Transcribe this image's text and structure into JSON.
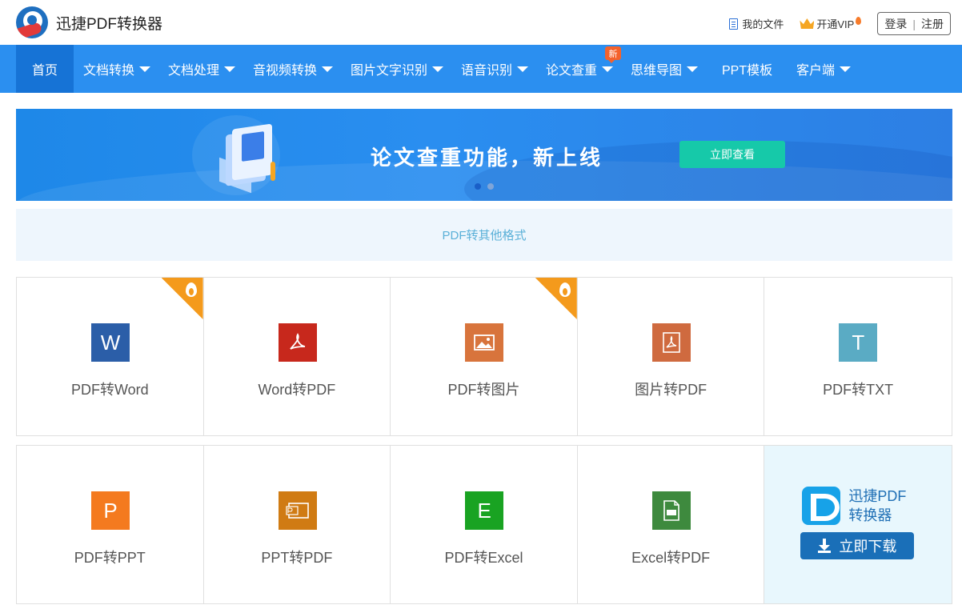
{
  "header": {
    "brand": "迅捷PDF转换器",
    "my_files": "我的文件",
    "vip": "开通VIP",
    "login": "登录",
    "separator": "|",
    "register": "注册"
  },
  "nav": {
    "items": [
      {
        "label": "首页",
        "dropdown": false,
        "active": true
      },
      {
        "label": "文档转换",
        "dropdown": true
      },
      {
        "label": "文档处理",
        "dropdown": true
      },
      {
        "label": "音视频转换",
        "dropdown": true
      },
      {
        "label": "图片文字识别",
        "dropdown": true
      },
      {
        "label": "语音识别",
        "dropdown": true
      },
      {
        "label": "论文查重",
        "dropdown": true
      },
      {
        "label": "思维导图",
        "dropdown": true
      },
      {
        "label": "PPT模板",
        "dropdown": false
      },
      {
        "label": "客户端",
        "dropdown": true
      }
    ],
    "new_badge": "新"
  },
  "banner": {
    "text": "论文查重功能，新上线",
    "button": "立即查看"
  },
  "section": {
    "title": "PDF转其他格式"
  },
  "tools_row1": [
    {
      "label": "PDF转Word",
      "glyph": "W",
      "color": "#2b5ea8",
      "hot": true,
      "icon": "word-icon"
    },
    {
      "label": "Word转PDF",
      "glyph": "",
      "color": "#c7281c",
      "hot": false,
      "icon": "pdf-icon"
    },
    {
      "label": "PDF转图片",
      "glyph": "",
      "color": "#d8743c",
      "hot": true,
      "icon": "image-icon"
    },
    {
      "label": "图片转PDF",
      "glyph": "",
      "color": "#cf6a3f",
      "hot": false,
      "icon": "pdf-doc-icon"
    },
    {
      "label": "PDF转TXT",
      "glyph": "T",
      "color": "#5aabc4",
      "hot": false,
      "icon": "txt-icon"
    }
  ],
  "tools_row2": [
    {
      "label": "PDF转PPT",
      "glyph": "P",
      "color": "#f47a1f",
      "icon": "ppt-icon"
    },
    {
      "label": "PPT转PDF",
      "glyph": "",
      "color": "#d07b13",
      "icon": "ppt-pdf-icon"
    },
    {
      "label": "PDF转Excel",
      "glyph": "E",
      "color": "#19a322",
      "icon": "excel-icon"
    },
    {
      "label": "Excel转PDF",
      "glyph": "",
      "color": "#3e8a3e",
      "icon": "excel-pdf-icon"
    }
  ],
  "promo": {
    "name": "迅捷PDF转换器",
    "name_line1": "迅捷PDF",
    "name_line2": "转换器",
    "button": "立即下载"
  }
}
